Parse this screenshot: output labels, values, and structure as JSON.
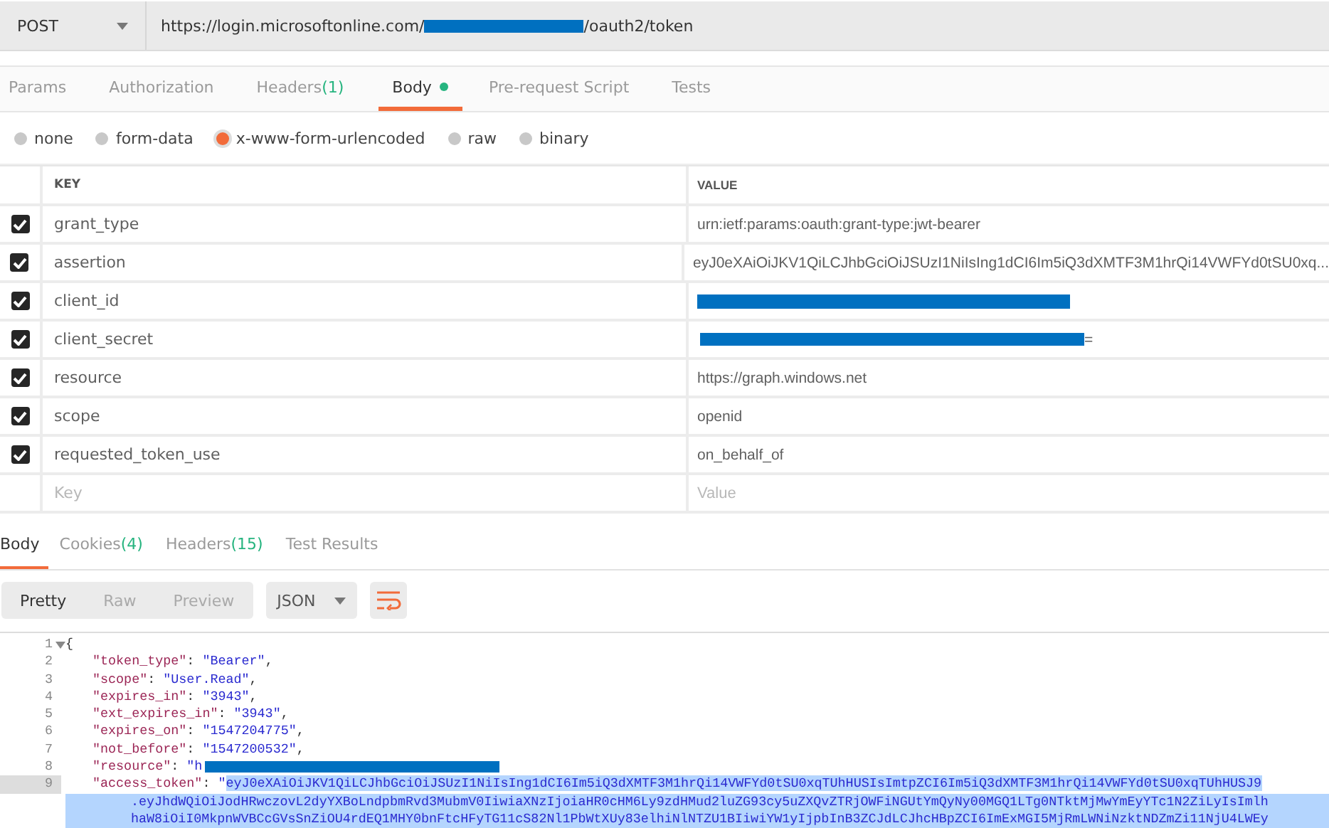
{
  "request_bar": {
    "method": "POST",
    "url_start": "https://login.microsoftonline.com/",
    "url_redacted": true,
    "url_end": "/oauth2/token"
  },
  "request_tabs": [
    {
      "label": "Params",
      "dot": false,
      "selected": false
    },
    {
      "label": "Authorization",
      "dot": false,
      "selected": false
    },
    {
      "label": "Headers",
      "count": "(1)",
      "dot": false,
      "selected": false
    },
    {
      "label": "Body",
      "dot": true,
      "selected": true
    },
    {
      "label": "Pre-request Script",
      "dot": false,
      "selected": false
    },
    {
      "label": "Tests",
      "dot": false,
      "selected": false
    }
  ],
  "body_modes": [
    {
      "label": "none",
      "selected": false
    },
    {
      "label": "form-data",
      "selected": false
    },
    {
      "label": "x-www-form-urlencoded",
      "selected": true
    },
    {
      "label": "raw",
      "selected": false
    },
    {
      "label": "binary",
      "selected": false
    }
  ],
  "params_table": {
    "columns": [
      "KEY",
      "VALUE"
    ],
    "rows": [
      {
        "key": "grant_type",
        "value": "urn:ietf:params:oauth:grant-type:jwt-bearer",
        "checked": true,
        "redacted": false
      },
      {
        "key": "assertion",
        "value": "eyJ0eXAiOiJKV1QiLCJhbGciOiJSUzI1NiIsIng1dCI6Im5iQ3dXMTF3M1hrQi14VWFYd0tSU0xq...",
        "checked": true,
        "redacted": false
      },
      {
        "key": "client_id",
        "value": "",
        "checked": true,
        "redacted": true
      },
      {
        "key": "client_secret",
        "value": "=",
        "checked": true,
        "redacted": true
      },
      {
        "key": "resource",
        "value": "https://graph.windows.net",
        "checked": true,
        "redacted": false
      },
      {
        "key": "scope",
        "value": "openid",
        "checked": true,
        "redacted": false
      },
      {
        "key": "requested_token_use",
        "value": "on_behalf_of",
        "checked": true,
        "redacted": false
      }
    ],
    "new_row": {
      "key_placeholder": "Key",
      "value_placeholder": "Value"
    }
  },
  "response_tabs": [
    {
      "label": "Body",
      "selected": true
    },
    {
      "label": "Cookies",
      "count": "(4)",
      "selected": false
    },
    {
      "label": "Headers",
      "count": "(15)",
      "selected": false
    },
    {
      "label": "Test Results",
      "selected": false
    }
  ],
  "view_modes": [
    {
      "label": "Pretty",
      "selected": true
    },
    {
      "label": "Raw",
      "selected": false
    },
    {
      "label": "Preview",
      "selected": false
    }
  ],
  "format": "JSON",
  "code_lines": [
    {
      "number": "1",
      "foldable": true,
      "selected": false,
      "parts": [
        {
          "kind": "punct",
          "text": "{"
        }
      ]
    },
    {
      "number": "2",
      "foldable": false,
      "selected": false,
      "parts": [
        {
          "kind": "key",
          "text": "\"token_type\""
        },
        {
          "kind": "punct",
          "text": ": "
        },
        {
          "kind": "string",
          "text": "\"Bearer\""
        },
        {
          "kind": "punct",
          "text": ","
        }
      ]
    },
    {
      "number": "3",
      "foldable": false,
      "selected": false,
      "parts": [
        {
          "kind": "key",
          "text": "\"scope\""
        },
        {
          "kind": "punct",
          "text": ": "
        },
        {
          "kind": "string",
          "text": "\"User.Read\""
        },
        {
          "kind": "punct",
          "text": ","
        }
      ]
    },
    {
      "number": "4",
      "foldable": false,
      "selected": false,
      "parts": [
        {
          "kind": "key",
          "text": "\"expires_in\""
        },
        {
          "kind": "punct",
          "text": ": "
        },
        {
          "kind": "string",
          "text": "\"3943\""
        },
        {
          "kind": "punct",
          "text": ","
        }
      ]
    },
    {
      "number": "5",
      "foldable": false,
      "selected": false,
      "parts": [
        {
          "kind": "key",
          "text": "\"ext_expires_in\""
        },
        {
          "kind": "punct",
          "text": ": "
        },
        {
          "kind": "string",
          "text": "\"3943\""
        },
        {
          "kind": "punct",
          "text": ","
        }
      ]
    },
    {
      "number": "6",
      "foldable": false,
      "selected": false,
      "parts": [
        {
          "kind": "key",
          "text": "\"expires_on\""
        },
        {
          "kind": "punct",
          "text": ": "
        },
        {
          "kind": "string",
          "text": "\"1547204775\""
        },
        {
          "kind": "punct",
          "text": ","
        }
      ]
    },
    {
      "number": "7",
      "foldable": false,
      "selected": false,
      "parts": [
        {
          "kind": "key",
          "text": "\"not_before\""
        },
        {
          "kind": "punct",
          "text": ": "
        },
        {
          "kind": "string",
          "text": "\"1547200532\""
        },
        {
          "kind": "punct",
          "text": ","
        }
      ]
    },
    {
      "number": "8",
      "foldable": false,
      "selected": false,
      "parts": [
        {
          "kind": "key",
          "text": "\"resource\""
        },
        {
          "kind": "punct",
          "text": ": "
        },
        {
          "kind": "string",
          "text": "\"h"
        },
        {
          "kind": "redacted"
        }
      ]
    },
    {
      "number": "9",
      "foldable": false,
      "selected": true,
      "parts": [
        {
          "kind": "key",
          "text": "\"access_token\""
        },
        {
          "kind": "punct",
          "text": ": "
        },
        {
          "kind": "string",
          "text": "\""
        },
        {
          "kind": "selected",
          "text": "eyJ0eXAiOiJKV1QiLCJhbGciOiJSUzI1NiIsIng1dCI6Im5iQ3dXMTF3M1hrQi14VWFYd0tSU0xqTUhHUSIsImtpZCI6Im5iQ3dXMTF3M1hrQi14VWFYd0tSU0xqTUhHUSJ9"
        }
      ],
      "wrapped": [
        ".eyJhdWQiOiJodHRwczovL2dyYXBoLndpbmRvd3MubmV0IiwiaXNzIjoiaHR0cHM6Ly9zdHMud2luZG93cy5uZXQvZTRjOWFiNGUtYmQyNy00MGQ1LTg0NTktMjMwYmEyYTc1N2ZiLyIsImlh",
        "haW8iOiI0MkpnWVBCcGVsSnZiOU4rdEQ1MHY0bnFtcHFyTG11cS82Nl1PbWtXUy83elhiNlNTZU1BIiwiYW1yIjpbInB3ZCJdLCJhcHBpZCI6ImExMGI5MjRmLWNiNzktNDZmZi11NjU4LWEy"
      ]
    }
  ]
}
